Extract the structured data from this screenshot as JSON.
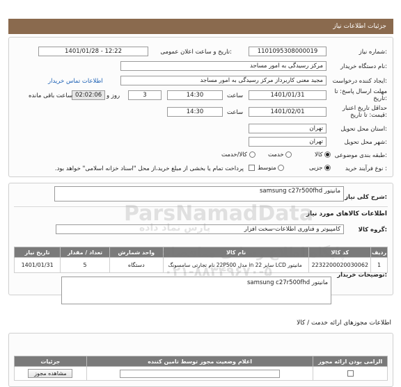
{
  "header": {
    "title": "جزئیات اطلاعات نیاز"
  },
  "info": {
    "need_number_label": "شماره نیاز:",
    "need_number": "1101095308000019",
    "announce_label": "تاریخ و ساعت اعلان عمومی:",
    "announce_value": "1401/01/28 - 12:22",
    "buyer_label": "نام دستگاه خریدار:",
    "buyer_value": "مرکز رسیدگی به امور مساجد",
    "creator_label": "ایجاد کننده درخواست:",
    "creator_value": "مجید معنی کاربرداز مرکز رسیدگی به امور مساجد",
    "contact_link": "اطلاعات تماس خریدار",
    "send_deadline_label": "مهلت ارسال پاسخ: تا تاریخ:",
    "send_date": "1401/01/31",
    "time_label": "ساعت",
    "send_time": "14:30",
    "days_value": "3",
    "days_label": "روز و",
    "remaining_time": "02:02:06",
    "remaining_label": "ساعت باقی مانده",
    "price_validity_label": "حداقل تاریخ اعتبار قیمت: تا تاریخ:",
    "price_date": "1401/02/01",
    "price_time": "14:30",
    "province_label": "استان محل تحویل:",
    "province_value": "تهران",
    "city_label": "شهر محل تحویل:",
    "city_value": "تهران",
    "category_label": "طبقه بندی موضوعی:",
    "category_options": [
      "کالا",
      "خدمت",
      "کالا/خدمت"
    ],
    "process_label": "نوع فرآیند خرید :",
    "process_options": [
      "جزیی",
      "متوسط"
    ],
    "payment_note": "پرداخت تمام یا بخشی از مبلغ خرید،از محل \"اسناد خزانه اسلامی\" خواهد بود."
  },
  "details": {
    "summary_label": "شرح کلی نیاز:",
    "summary_value": "مانیتور  samsung c27r500fhd",
    "goods_title": "اطلاعات کالاهای مورد نیاز",
    "group_label": "گروه کالا:",
    "group_value": "کامپیوتر و فناوری اطلاعات-سخت افزار",
    "table": {
      "headers": [
        "ردیف",
        "کد کالا",
        "نام کالا",
        "واحد شمارش",
        "تعداد / مقدار",
        "تاریخ نیاز"
      ],
      "rows": [
        [
          "1",
          "2232200020030062",
          "مانیتور LCD سایز 22 in مدل 22P500 نام تجارتی سامسونگ",
          "دستگاه",
          "5",
          "1401/01/31"
        ]
      ]
    },
    "buyer_notes_label": "توضیحات خریدار:",
    "buyer_notes_value": "مانیتور  samsung c27r500fhd"
  },
  "service": {
    "title": "اطلاعات مجوزهای ارائه خدمت / کالا",
    "headers": [
      "الزامی بودن ارائه مجوز",
      "اعلام وضعیت مجوز توسط تامین کننده",
      "جزئیات"
    ],
    "row_button": "مشاهده مجوز"
  },
  "watermark": {
    "brand": "ParsNamadData",
    "brand_fa": "پارس نماد داده",
    "line1": "پایگاه اطلاع رسانی مناقصات",
    "phone": "۰۲۱-۸۸۳۴۹۶۷۰-۵"
  }
}
